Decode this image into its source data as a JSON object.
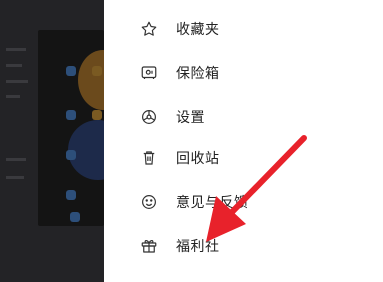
{
  "menu": {
    "items": [
      {
        "label": "收藏夹",
        "icon": "star-icon"
      },
      {
        "label": "保险箱",
        "icon": "safe-icon"
      },
      {
        "label": "设置",
        "icon": "settings-icon"
      },
      {
        "label": "回收站",
        "icon": "trash-icon"
      },
      {
        "label": "意见与反馈",
        "icon": "smile-icon"
      },
      {
        "label": "福利社",
        "icon": "gift-icon"
      }
    ]
  },
  "annotation": {
    "color": "#e8222b",
    "points_to": "福利社"
  },
  "colors": {
    "panel": "#ffffff",
    "overlay": "#1f1f22",
    "text": "#222222"
  }
}
